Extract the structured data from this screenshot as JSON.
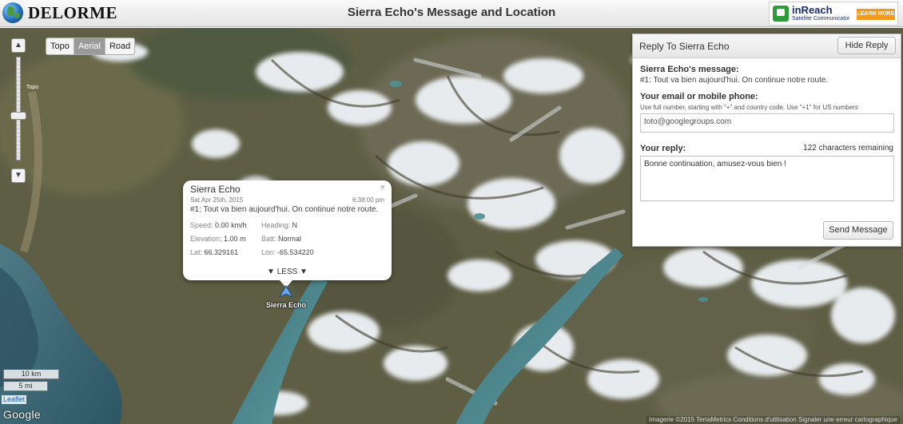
{
  "header": {
    "brand": "DELORME",
    "title": "Sierra Echo's Message and Location",
    "promo": {
      "name": "inReach",
      "subtitle": "Satellite Communicator",
      "cta": "LEARN MORE"
    }
  },
  "map": {
    "layers": [
      "Topo",
      "Aerial",
      "Road"
    ],
    "active_layer": "Aerial",
    "zoom": {
      "in": "▲",
      "out": "▼",
      "label": "Topo"
    },
    "scale": {
      "km": "10 km",
      "mi": "5 mi"
    },
    "attribution_leaflet": "Leaflet",
    "google": "Google",
    "attribution": "Imagerie ©2015 TerraMetrics   Conditions d'utilisation   Signaler une erreur cartographique",
    "marker_label": "Sierra Echo"
  },
  "popup": {
    "close": "×",
    "name": "Sierra Echo",
    "date": "Sat Apr 25th, 2015",
    "time": "6:38:00 pm",
    "message": "#1: Tout va bien aujourd'hui. On continue notre route.",
    "speed_label": "Speed:",
    "speed": "0.00 km/h",
    "heading_label": "Heading:",
    "heading": "N",
    "elevation_label": "Elevation:",
    "elevation": "1.00 m",
    "batt_label": "Batt:",
    "batt": "Normal",
    "lat_label": "Lat:",
    "lat": "66.329161",
    "lon_label": "Lon:",
    "lon": "-65.534220",
    "less": "▼ LESS ▼"
  },
  "reply": {
    "title": "Reply To Sierra Echo",
    "hide": "Hide Reply",
    "message_label": "Sierra Echo's message:",
    "message": "#1: Tout va bien aujourd'hui. On continue notre route.",
    "contact_label": "Your email or mobile phone:",
    "contact_hint": "Use full number, starting with \"+\" and country code. Use \"+1\" for US numbers",
    "contact_value": "toto@googlegroups.com",
    "reply_label": "Your reply:",
    "remaining": "122 characters remaining",
    "reply_value": "Bonne continuation, amusez-vous bien !",
    "send": "Send Message"
  }
}
